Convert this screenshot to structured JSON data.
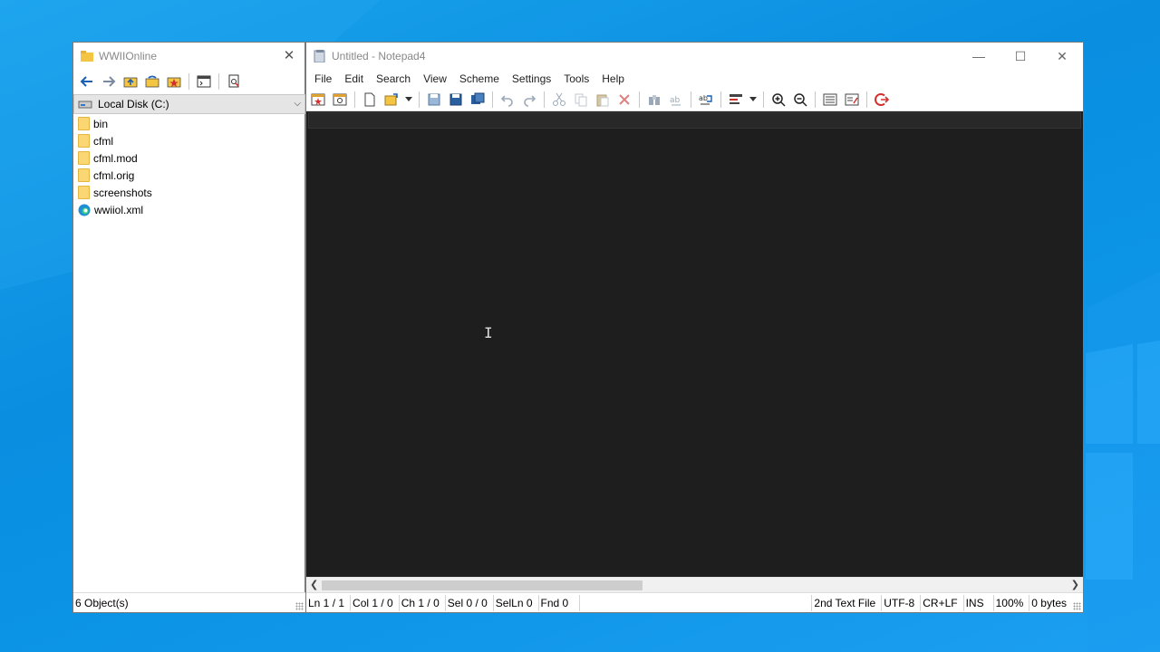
{
  "metapath": {
    "title": "WWIIOnline",
    "drive_label": "Local Disk (C:)",
    "items": [
      {
        "name": "bin",
        "type": "folder"
      },
      {
        "name": "cfml",
        "type": "folder"
      },
      {
        "name": "cfml.mod",
        "type": "folder"
      },
      {
        "name": "cfml.orig",
        "type": "folder"
      },
      {
        "name": "screenshots",
        "type": "folder"
      },
      {
        "name": "wwiiol.xml",
        "type": "edge-file"
      }
    ],
    "status": "6 Object(s)",
    "toolbar_icons": [
      "back-icon",
      "forward-icon",
      "up-folder-icon",
      "sync-folder-icon",
      "favorites-icon",
      "console-icon",
      "find-file-icon"
    ]
  },
  "notepad": {
    "title": "Untitled - Notepad4",
    "menu": [
      "File",
      "Edit",
      "Search",
      "View",
      "Scheme",
      "Settings",
      "Tools",
      "Help"
    ],
    "status": {
      "line": "Ln 1 / 1",
      "col": "Col 1 / 0",
      "ch": "Ch 1 / 0",
      "sel": "Sel 0 / 0",
      "selln": "SelLn 0",
      "fnd": "Fnd 0",
      "scheme": "2nd Text File",
      "encoding": "UTF-8",
      "eol": "CR+LF",
      "mode": "INS",
      "zoom": "100%",
      "size": "0 bytes"
    },
    "colors": {
      "editor_bg": "#1e1e1e",
      "desktop": "#0b93e6"
    }
  }
}
